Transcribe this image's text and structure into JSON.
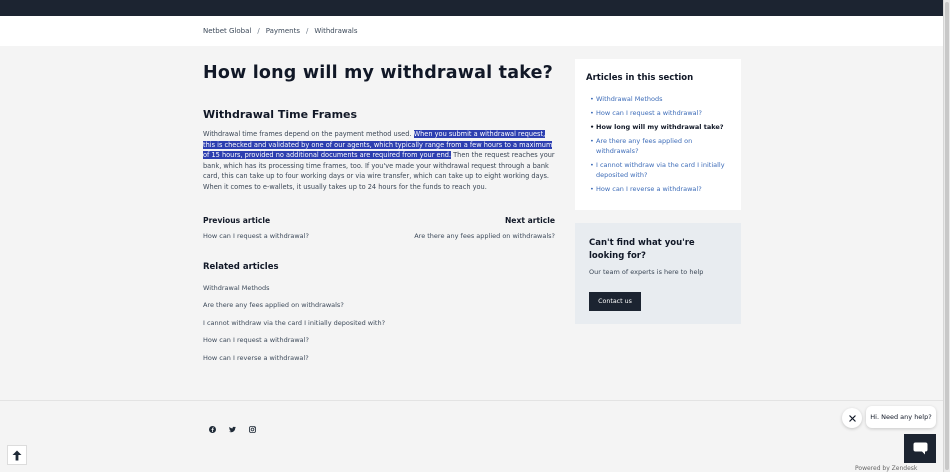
{
  "breadcrumb": {
    "items": [
      "Netbet Global",
      "Payments",
      "Withdrawals"
    ],
    "separator": "/"
  },
  "article": {
    "title": "How long will my withdrawal take?",
    "section_heading": "Withdrawal Time Frames",
    "body_plain_1": "Withdrawal time frames depend on the payment method used. ",
    "body_highlight": "When you submit a withdrawal request, this is checked and validated by one of our agents, which typically range from a few hours to a maximum of 15 hours, provided no additional documents are required from your end.",
    "body_plain_2": " Then the request reaches your bank, which has its processing time frames, too. If you've made your withdrawal request through a bank card, this can take up to four working days or via wire transfer, which can take up to eight working days. When it comes to e-wallets, it usually takes up to 24 hours for the funds to reach you."
  },
  "navigation": {
    "previous_label": "Previous article",
    "previous_link": "How can I request a withdrawal?",
    "next_label": "Next article",
    "next_link": "Are there any fees applied on withdrawals?"
  },
  "related": {
    "heading": "Related articles",
    "items": [
      "Withdrawal Methods",
      "Are there any fees applied on withdrawals?",
      "I cannot withdraw via the card I initially deposited with?",
      "How can I request a withdrawal?",
      "How can I reverse a withdrawal?"
    ]
  },
  "sidebar": {
    "title": "Articles in this section",
    "items": [
      "Withdrawal Methods",
      "How can I request a withdrawal?",
      "How long will my withdrawal take?",
      "Are there any fees applied on withdrawals?",
      "I cannot withdraw via the card I initially deposited with?",
      "How can I reverse a withdrawal?"
    ],
    "active_index": 2
  },
  "help": {
    "title": "Can't find what you're looking for?",
    "text": "Our team of experts is here to help",
    "button": "Contact us"
  },
  "footer": {
    "social_icons": [
      "facebook-icon",
      "twitter-icon",
      "instagram-icon"
    ]
  },
  "chat": {
    "bubble_text": "Hi. Need any help?",
    "powered_by": "Powered by Zendesk"
  },
  "colors": {
    "topbar": "#1c2431",
    "highlight": "#2d3fb0",
    "link": "#3d6cb8",
    "button": "#1c2431"
  }
}
